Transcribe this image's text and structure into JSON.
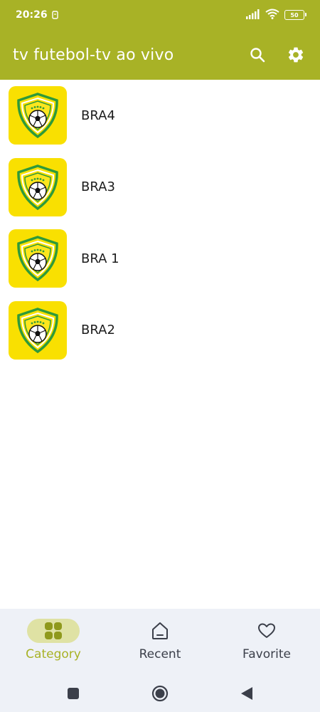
{
  "status_bar": {
    "time": "20:26",
    "battery": "50"
  },
  "app_bar": {
    "title": "tv futebol-tv ao vivo",
    "color": "#a8b226"
  },
  "channels": [
    {
      "name": "BRA4",
      "icon": "shield-soccer-logo"
    },
    {
      "name": "BRA3",
      "icon": "shield-soccer-logo"
    },
    {
      "name": "BRA 1",
      "icon": "shield-soccer-logo"
    },
    {
      "name": "BRA2",
      "icon": "shield-soccer-logo"
    }
  ],
  "bottom_nav": {
    "items": [
      {
        "label": "Category",
        "icon": "grid-icon",
        "active": true
      },
      {
        "label": "Recent",
        "icon": "home-icon",
        "active": false
      },
      {
        "label": "Favorite",
        "icon": "heart-icon",
        "active": false
      }
    ]
  },
  "colors": {
    "accent": "#a8b226",
    "logo_background": "#f9e001",
    "nav_background": "#eef1f7"
  }
}
